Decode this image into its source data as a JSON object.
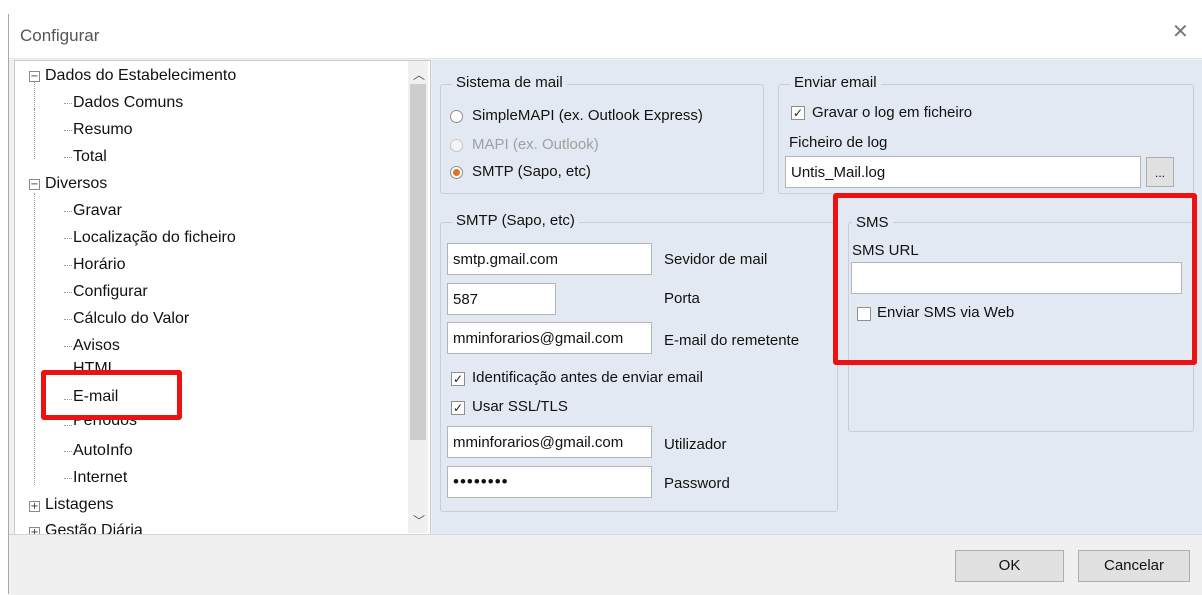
{
  "window": {
    "title": "Configurar"
  },
  "tree": {
    "items": [
      {
        "label": "Dados do Estabelecimento",
        "expander": "−"
      },
      {
        "label": "Dados Comuns"
      },
      {
        "label": "Resumo"
      },
      {
        "label": "Total"
      },
      {
        "label": "Diversos",
        "expander": "−"
      },
      {
        "label": "Gravar"
      },
      {
        "label": "Localização do ficheiro"
      },
      {
        "label": "Horário"
      },
      {
        "label": "Configurar"
      },
      {
        "label": "Cálculo do Valor"
      },
      {
        "label": "Avisos"
      },
      {
        "label": "HTML"
      },
      {
        "label": "E-mail",
        "selected": true
      },
      {
        "label": "Períodos"
      },
      {
        "label": "AutoInfo"
      },
      {
        "label": "Internet"
      },
      {
        "label": "Listagens",
        "expander": "+"
      },
      {
        "label": "Gestão Diária",
        "expander": "+"
      }
    ]
  },
  "mail_system": {
    "legend": "Sistema de mail",
    "options": [
      {
        "label": "SimpleMAPI (ex. Outlook Express)",
        "selected": false,
        "disabled": false
      },
      {
        "label": "MAPI (ex. Outlook)",
        "selected": false,
        "disabled": true
      },
      {
        "label": "SMTP (Sapo, etc)",
        "selected": true,
        "disabled": false
      }
    ]
  },
  "send_email": {
    "legend": "Enviar email",
    "log_checkbox": "Gravar o log em ficheiro",
    "log_checked": true,
    "log_file_label": "Ficheiro de log",
    "log_file_value": "Untis_Mail.log",
    "browse_label": "..."
  },
  "smtp": {
    "legend": "SMTP (Sapo, etc)",
    "server_value": "smtp.gmail.com",
    "server_label": "Sevidor de mail",
    "port_value": "587",
    "port_label": "Porta",
    "sender_value": "mminforarios@gmail.com",
    "sender_label": "E-mail do remetente",
    "auth_label": "Identificação antes de enviar email",
    "auth_checked": true,
    "ssl_label": "Usar SSL/TLS",
    "ssl_checked": true,
    "user_value": "mminforarios@gmail.com",
    "user_label": "Utilizador",
    "password_value": "••••••••",
    "password_label": "Password"
  },
  "sms": {
    "legend": "SMS",
    "url_label": "SMS URL",
    "url_value": "",
    "web_label": "Enviar SMS via Web",
    "web_checked": false
  },
  "footer": {
    "ok_label": "OK",
    "cancel_label": "Cancelar"
  },
  "colors": {
    "highlight": "#ee1111",
    "panel": "#e3e9f3",
    "radio_selected": "#e2731f"
  },
  "check_mark": "✓"
}
